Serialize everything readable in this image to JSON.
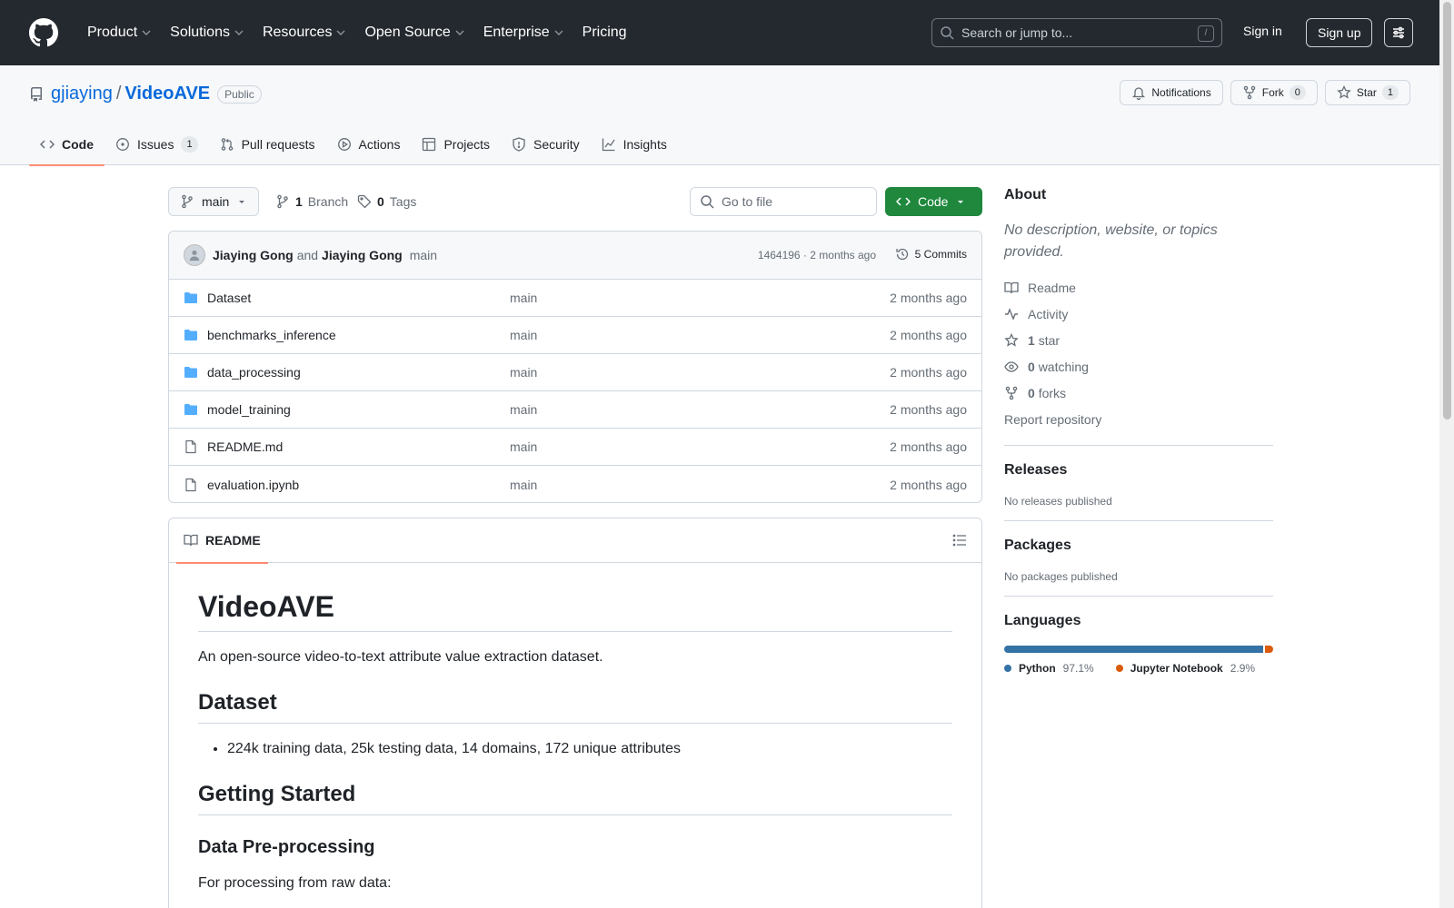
{
  "header": {
    "nav": [
      {
        "label": "Product",
        "has_dropdown": true
      },
      {
        "label": "Solutions",
        "has_dropdown": true
      },
      {
        "label": "Resources",
        "has_dropdown": true
      },
      {
        "label": "Open Source",
        "has_dropdown": true
      },
      {
        "label": "Enterprise",
        "has_dropdown": true
      },
      {
        "label": "Pricing",
        "has_dropdown": false
      }
    ],
    "search_placeholder": "Search or jump to...",
    "search_shortcut": "/",
    "sign_in": "Sign in",
    "sign_up": "Sign up"
  },
  "repo": {
    "owner": "gjiaying",
    "separator": "/",
    "name": "VideoAVE",
    "visibility": "Public",
    "actions": {
      "notifications": "Notifications",
      "fork": "Fork",
      "fork_count": "0",
      "star": "Star",
      "star_count": "1"
    },
    "tabs": [
      {
        "label": "Code",
        "icon": "code-icon",
        "active": true
      },
      {
        "label": "Issues",
        "icon": "issue-icon",
        "count": "1"
      },
      {
        "label": "Pull requests",
        "icon": "pull-request-icon"
      },
      {
        "label": "Actions",
        "icon": "play-icon"
      },
      {
        "label": "Projects",
        "icon": "table-icon"
      },
      {
        "label": "Security",
        "icon": "shield-icon"
      },
      {
        "label": "Insights",
        "icon": "graph-icon"
      }
    ]
  },
  "toolbar": {
    "branch": "main",
    "branch_count": "1",
    "branch_label": "Branch",
    "tag_count": "0",
    "tag_label": "Tags",
    "goto_placeholder": "Go to file",
    "code_button": "Code"
  },
  "commit": {
    "author1": "Jiaying Gong",
    "and": "and",
    "author2": "Jiaying Gong",
    "message": "main",
    "meta": "1464196 · 2 months ago",
    "commits": "5 Commits"
  },
  "files": [
    {
      "name": "Dataset",
      "type": "folder",
      "message": "main",
      "age": "2 months ago"
    },
    {
      "name": "benchmarks_inference",
      "type": "folder",
      "message": "main",
      "age": "2 months ago"
    },
    {
      "name": "data_processing",
      "type": "folder",
      "message": "main",
      "age": "2 months ago"
    },
    {
      "name": "model_training",
      "type": "folder",
      "message": "main",
      "age": "2 months ago"
    },
    {
      "name": "README.md",
      "type": "file",
      "message": "main",
      "age": "2 months ago"
    },
    {
      "name": "evaluation.ipynb",
      "type": "file",
      "message": "main",
      "age": "2 months ago"
    }
  ],
  "readme": {
    "tab_label": "README",
    "title": "VideoAVE",
    "intro": "An open-source video-to-text attribute value extraction dataset.",
    "h_dataset": "Dataset",
    "bullet1": "224k training data, 25k testing data, 14 domains, 172 unique attributes",
    "h_getting_started": "Getting Started",
    "h_preprocessing": "Data Pre-processing",
    "preprocessing_text": "For processing from raw data:"
  },
  "sidebar": {
    "about_title": "About",
    "about_desc": "No description, website, or topics provided.",
    "links": [
      {
        "icon": "book-icon",
        "label": "Readme"
      },
      {
        "icon": "pulse-icon",
        "label": "Activity"
      },
      {
        "icon": "star-icon",
        "count": "1",
        "label": "star"
      },
      {
        "icon": "eye-icon",
        "count": "0",
        "label": "watching"
      },
      {
        "icon": "fork-icon",
        "count": "0",
        "label": "forks"
      }
    ],
    "report": "Report repository",
    "releases_title": "Releases",
    "releases_text": "No releases published",
    "packages_title": "Packages",
    "packages_text": "No packages published",
    "languages_title": "Languages",
    "languages": [
      {
        "name": "Python",
        "percent": "97.1%",
        "share": 97.1,
        "color": "#3572A5"
      },
      {
        "name": "Jupyter Notebook",
        "percent": "2.9%",
        "share": 2.9,
        "color": "#DA5B0B"
      }
    ]
  },
  "colors": {
    "header_bg": "#24292f",
    "link": "#0969da",
    "primary_button": "#1f883d",
    "active_tab_underline": "#fd8c73",
    "folder_icon": "#54aeff"
  }
}
